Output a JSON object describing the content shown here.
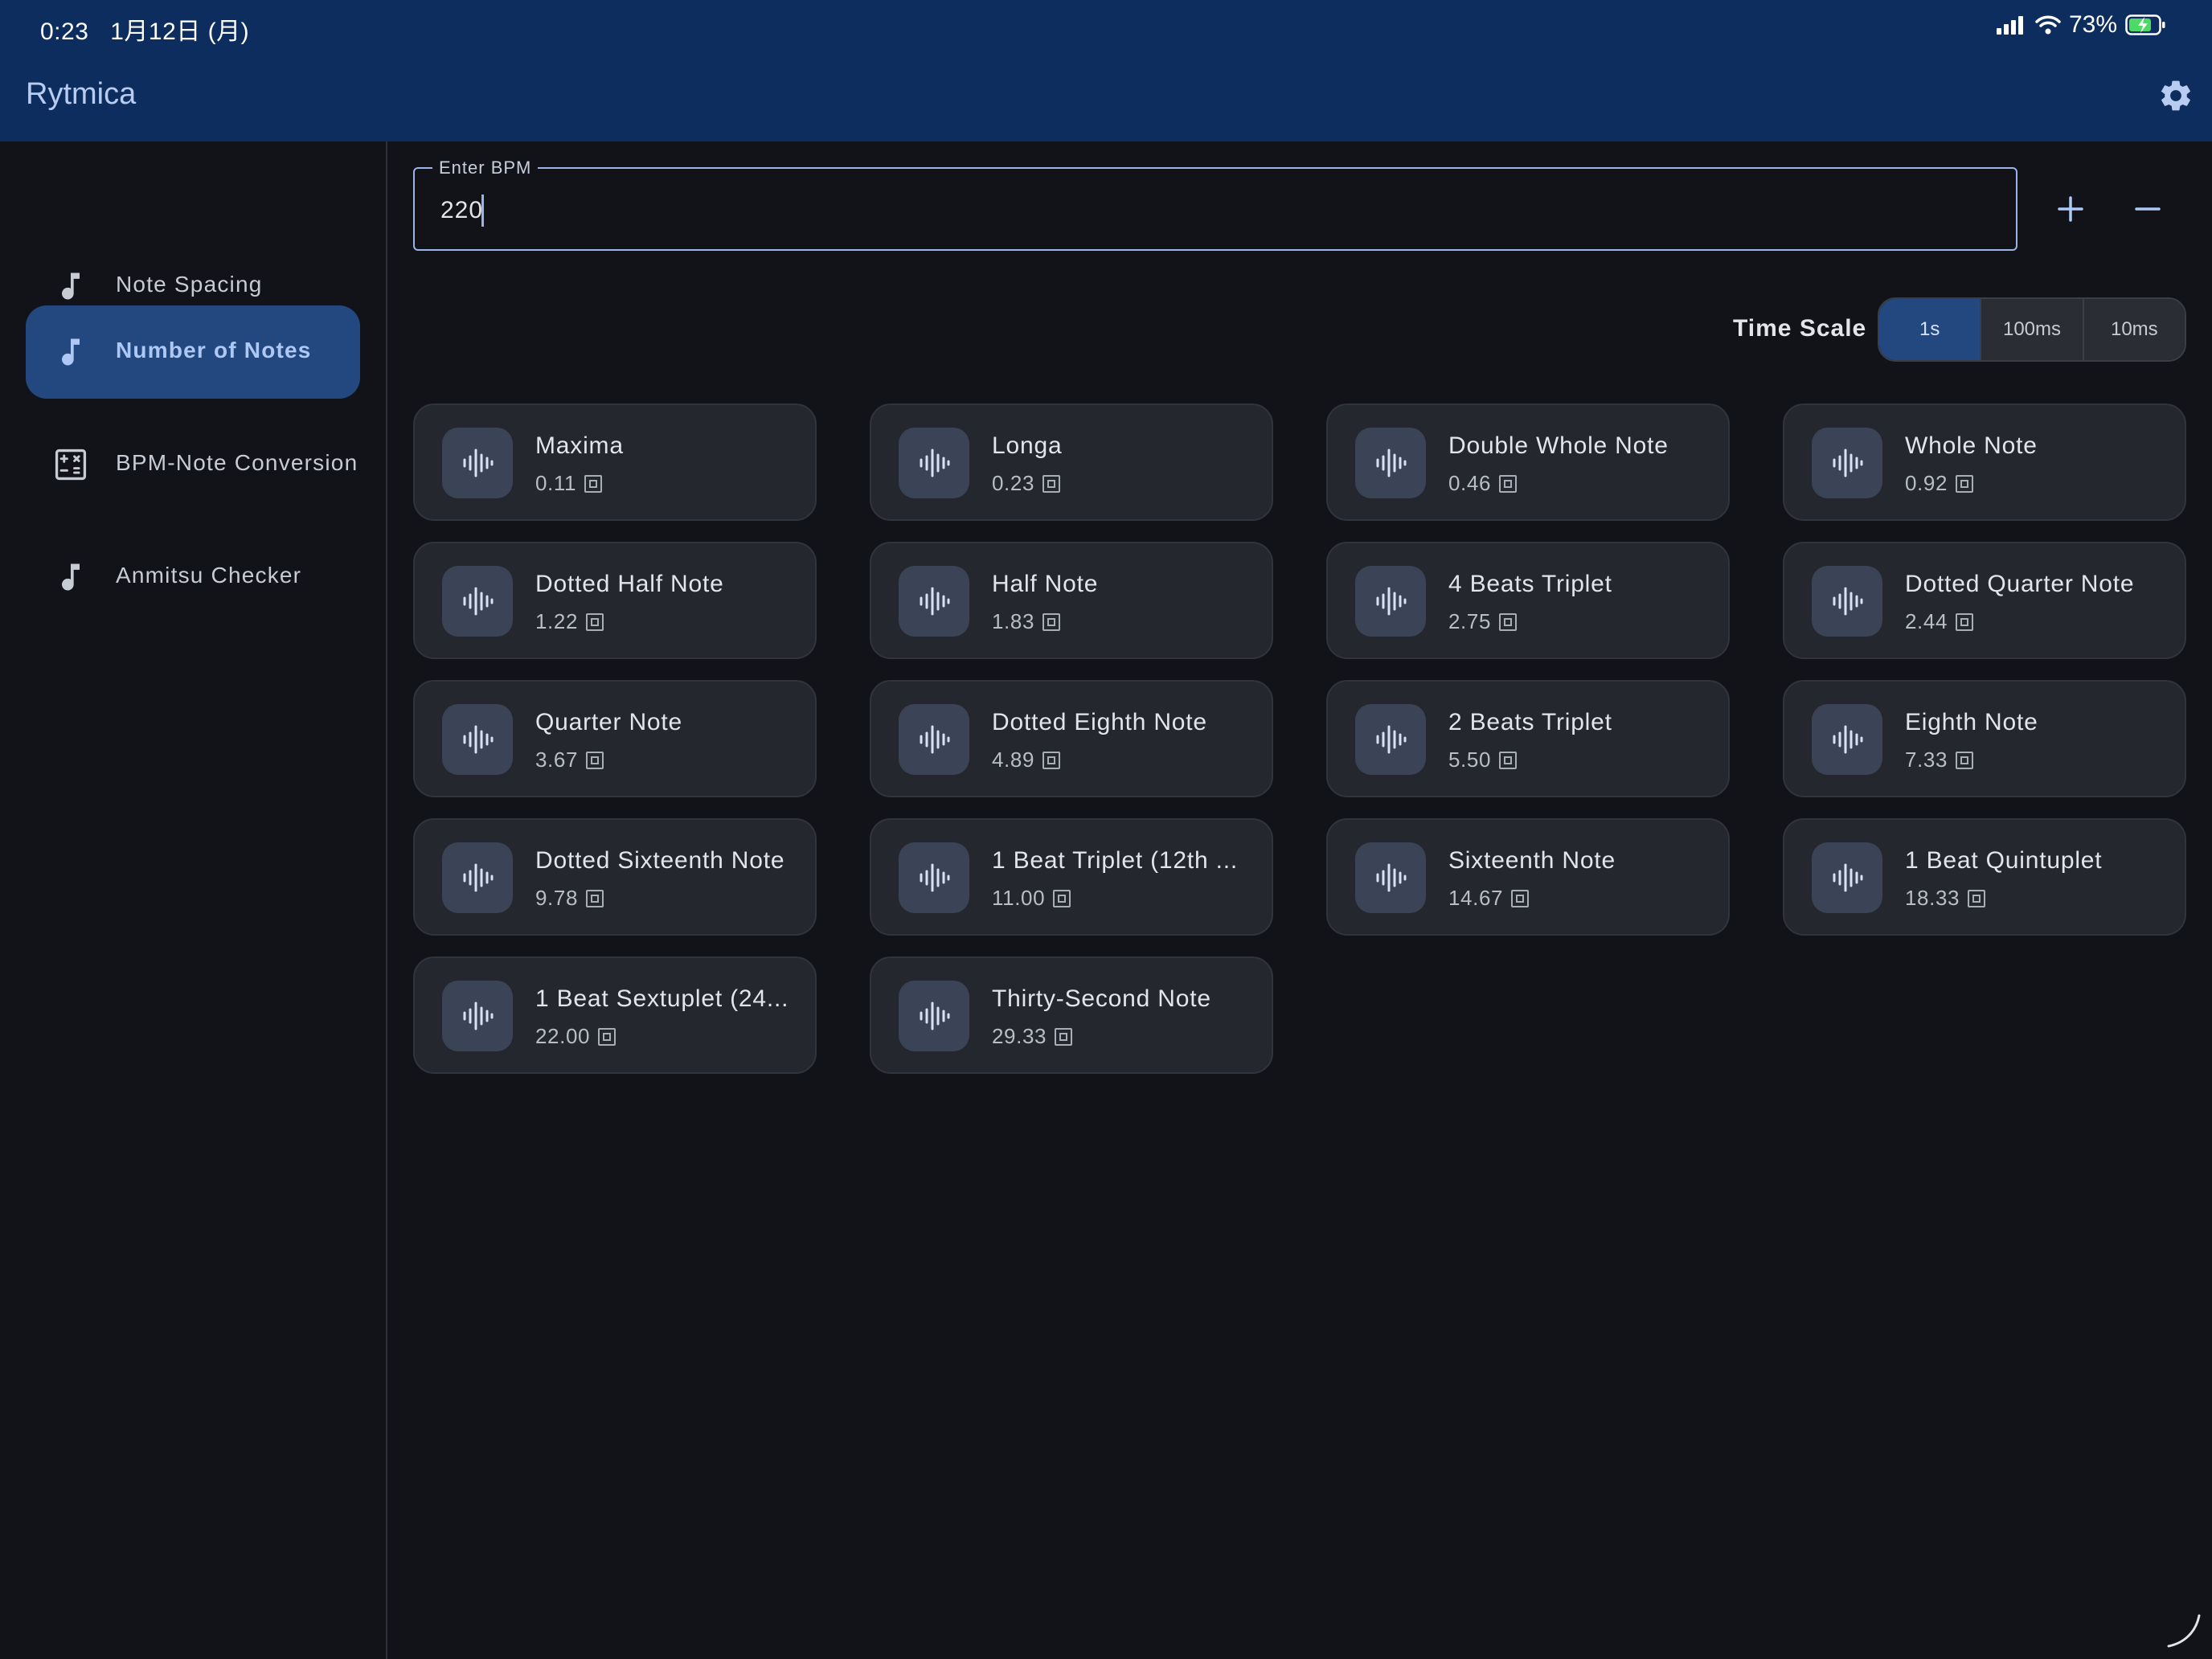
{
  "status_bar": {
    "time": "0:23",
    "date": "1月12日 (月)",
    "battery": "73%"
  },
  "app": {
    "title": "Rytmica"
  },
  "sidebar": {
    "items": [
      {
        "label": "Note Spacing",
        "icon": "music-note-icon",
        "active": false
      },
      {
        "label": "Number of Notes",
        "icon": "music-note-icon",
        "active": true
      },
      {
        "label": "BPM-Note Conversion",
        "icon": "calculator-icon",
        "active": false
      },
      {
        "label": "Anmitsu Checker",
        "icon": "music-note-icon",
        "active": false
      }
    ]
  },
  "bpm": {
    "label": "Enter BPM",
    "value": "220"
  },
  "time_scale": {
    "label": "Time Scale",
    "options": [
      "1s",
      "100ms",
      "10ms"
    ],
    "selected": "1s"
  },
  "notes": [
    {
      "name": "Maxima",
      "value": "0.11"
    },
    {
      "name": "Longa",
      "value": "0.23"
    },
    {
      "name": "Double Whole Note",
      "value": "0.46"
    },
    {
      "name": "Whole Note",
      "value": "0.92"
    },
    {
      "name": "Dotted Half Note",
      "value": "1.22"
    },
    {
      "name": "Half Note",
      "value": "1.83"
    },
    {
      "name": "4 Beats Triplet",
      "value": "2.75"
    },
    {
      "name": "Dotted Quarter Note",
      "value": "2.44"
    },
    {
      "name": "Quarter Note",
      "value": "3.67"
    },
    {
      "name": "Dotted Eighth Note",
      "value": "4.89"
    },
    {
      "name": "2 Beats Triplet",
      "value": "5.50"
    },
    {
      "name": "Eighth Note",
      "value": "7.33"
    },
    {
      "name": "Dotted Sixteenth Note",
      "value": "9.78"
    },
    {
      "name": "1 Beat Triplet (12th ...",
      "value": "11.00"
    },
    {
      "name": "Sixteenth Note",
      "value": "14.67"
    },
    {
      "name": "1 Beat Quintuplet",
      "value": "18.33"
    },
    {
      "name": "1 Beat Sextuplet (24...",
      "value": "22.00"
    },
    {
      "name": "Thirty-Second Note",
      "value": "29.33"
    }
  ],
  "colors": {
    "app_bar": "#0c2d5e",
    "background": "#111318",
    "accent": "#234880",
    "card": "#24272d"
  }
}
